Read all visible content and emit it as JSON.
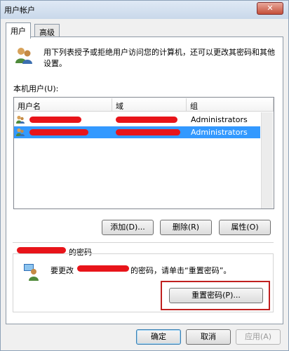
{
  "window": {
    "title": "用户帐户",
    "close_glyph": "✕"
  },
  "tabs": [
    {
      "label": "用户"
    },
    {
      "label": "高级"
    }
  ],
  "description": "用下列表授予或拒绝用户访问您的计算机，还可以更改其密码和其他设置。",
  "list": {
    "label": "本机用户(U):",
    "columns": [
      "用户名",
      "域",
      "组"
    ],
    "rows": [
      {
        "group": "Administrators",
        "selected": false
      },
      {
        "group": "Administrators",
        "selected": true
      }
    ]
  },
  "list_buttons": {
    "add": "添加(D)...",
    "remove": "删除(R)",
    "properties": "属性(O)"
  },
  "password_section": {
    "title_suffix": "的密码",
    "text_prefix": "要更改",
    "text_suffix": "的密码，请单击“重置密码”。",
    "reset_button": "重置密码(P)..."
  },
  "footer": {
    "ok": "确定",
    "cancel": "取消",
    "apply": "应用(A)"
  },
  "colors": {
    "selection": "#3399ff",
    "redaction": "#e8141a",
    "highlight": "#c0201f"
  }
}
